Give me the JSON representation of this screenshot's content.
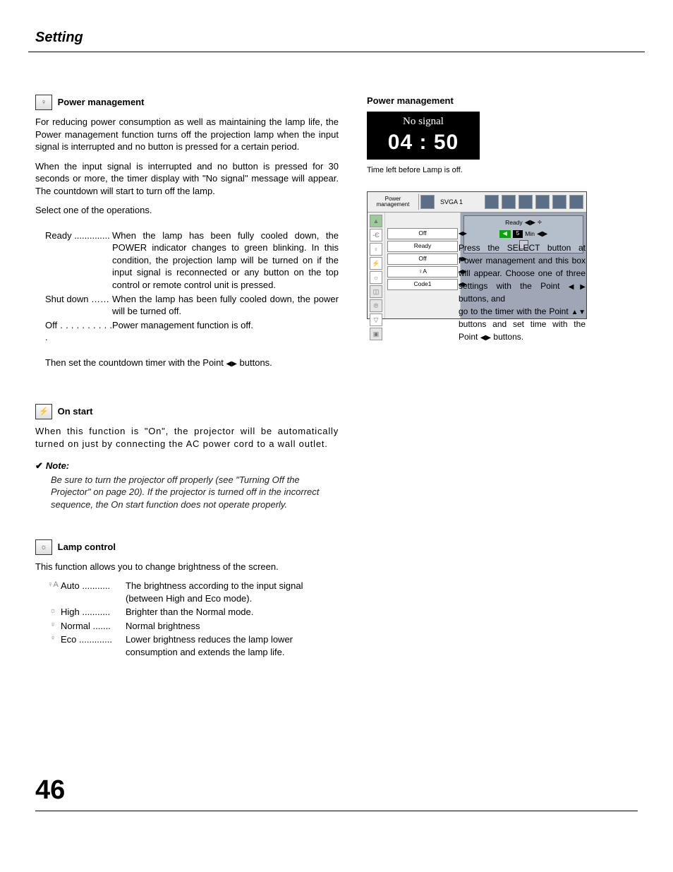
{
  "page": {
    "title": "Setting",
    "number": "46"
  },
  "pm": {
    "heading": "Power management",
    "p1": "For reducing power consumption as well as maintaining the lamp life, the Power management function turns off the projection lamp when the input signal is interrupted and no button is pressed for a certain period.",
    "p2": "When the input signal is interrupted and no button is pressed for 30 seconds or more, the timer display with \"No signal\" message will appear.  The countdown will start to turn off the lamp.",
    "p3": "Select one of the operations.",
    "ready_label": "Ready ..............",
    "ready_desc": "When the lamp has been fully cooled down, the POWER indicator changes to green blinking. In this condition, the projection lamp will be turned on if the input signal is reconnected or any button on the top control or remote control unit is pressed.",
    "shutdown_label": "Shut down ……",
    "shutdown_desc": "When the lamp has been fully cooled down, the power will be turned off.",
    "off_label": "Off . . . . . . . . . . .",
    "off_desc": "Power management function is off.",
    "p4a": "Then set the countdown timer with the Point ",
    "p4b": " buttons."
  },
  "onstart": {
    "heading": "On start",
    "p1": "When this function is \"On\", the projector will be automatically turned on just by connecting the AC power cord to a wall outlet.",
    "note_head": "Note:",
    "note_body": "Be sure to turn the projector off properly (see \"Turning Off the Projector\" on page 20).  If the projector is turned off in the incorrect sequence, the On start function does not operate properly."
  },
  "lamp": {
    "heading": "Lamp control",
    "p1": "This function allows you to change brightness of the screen.",
    "auto_label": "Auto ...........",
    "auto_desc": "The brightness according to the input signal (between High and Eco mode).",
    "high_label": "High ...........",
    "high_desc": "Brighter than the Normal mode.",
    "normal_label": "Normal .......",
    "normal_desc": "Normal brightness",
    "eco_label": "Eco .............",
    "eco_desc": "Lower brightness reduces the lamp lower consumption and extends the lamp life."
  },
  "right": {
    "heading": "Power management",
    "no_signal": "No signal",
    "time": "04 : 50",
    "caption": "Time left before Lamp is off.",
    "osd_title": "Power management",
    "svga": "SVGA 1",
    "list": {
      "off1": "Off",
      "ready": "Ready",
      "off2": "Off",
      "lamp": "♀A",
      "code": "Code1"
    },
    "sub": {
      "ready": "Ready",
      "min_value": "5",
      "min": "Min"
    },
    "instr1": "Press the SELECT button at Power management and this box will appear. Choose one of three settings with the Point ",
    "instr2": " buttons, and",
    "instr3": "go to the timer with the Point ",
    "instr4": " buttons and set time with the Point ",
    "instr5": " buttons."
  },
  "glyphs": {
    "lr": "◀▶",
    "ud": "▲▼"
  }
}
